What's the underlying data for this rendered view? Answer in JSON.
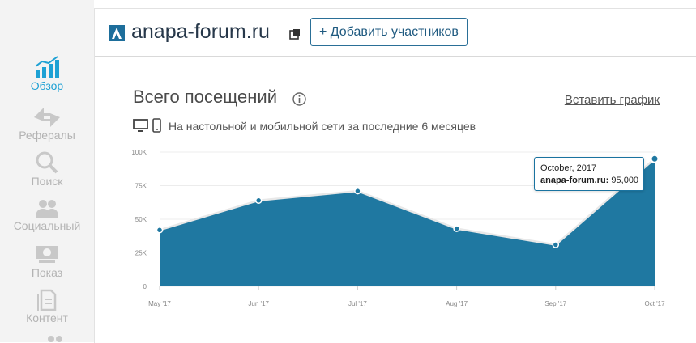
{
  "sidebar": {
    "items": [
      {
        "label": "Обзор",
        "icon": "chart-bars-icon",
        "active": true
      },
      {
        "label": "Рефералы",
        "icon": "arrows-icon",
        "active": false
      },
      {
        "label": "Поиск",
        "icon": "magnifier-icon",
        "active": false
      },
      {
        "label": "Социальный",
        "icon": "people-icon",
        "active": false
      },
      {
        "label": "Показ",
        "icon": "money-icon",
        "active": false
      },
      {
        "label": "Контент",
        "icon": "document-icon",
        "active": false
      }
    ]
  },
  "header": {
    "site": "anapa-forum.ru",
    "add_button": "+ Добавить участников"
  },
  "panel": {
    "title": "Всего посещений",
    "embed_link": "Вставить график",
    "subtitle": "На настольной и мобильной сети за последние 6 месяцев"
  },
  "tooltip": {
    "date": "October, 2017",
    "series": "anapa-forum.ru:",
    "value": "95,000"
  },
  "colors": {
    "accent": "#1ea1d4",
    "area": "#1f78a1",
    "line": "#e8e8e8"
  },
  "chart_data": {
    "type": "area",
    "categories": [
      "May '17",
      "Jun '17",
      "Jul '17",
      "Aug '17",
      "Sep '17",
      "Oct '17"
    ],
    "series": [
      {
        "name": "anapa-forum.ru",
        "values": [
          42000,
          64000,
          71000,
          43000,
          31000,
          95000
        ]
      }
    ],
    "yticks": [
      "100K",
      "75K",
      "50K",
      "25K",
      "0"
    ],
    "ylim": [
      0,
      100000
    ],
    "grid": true
  }
}
